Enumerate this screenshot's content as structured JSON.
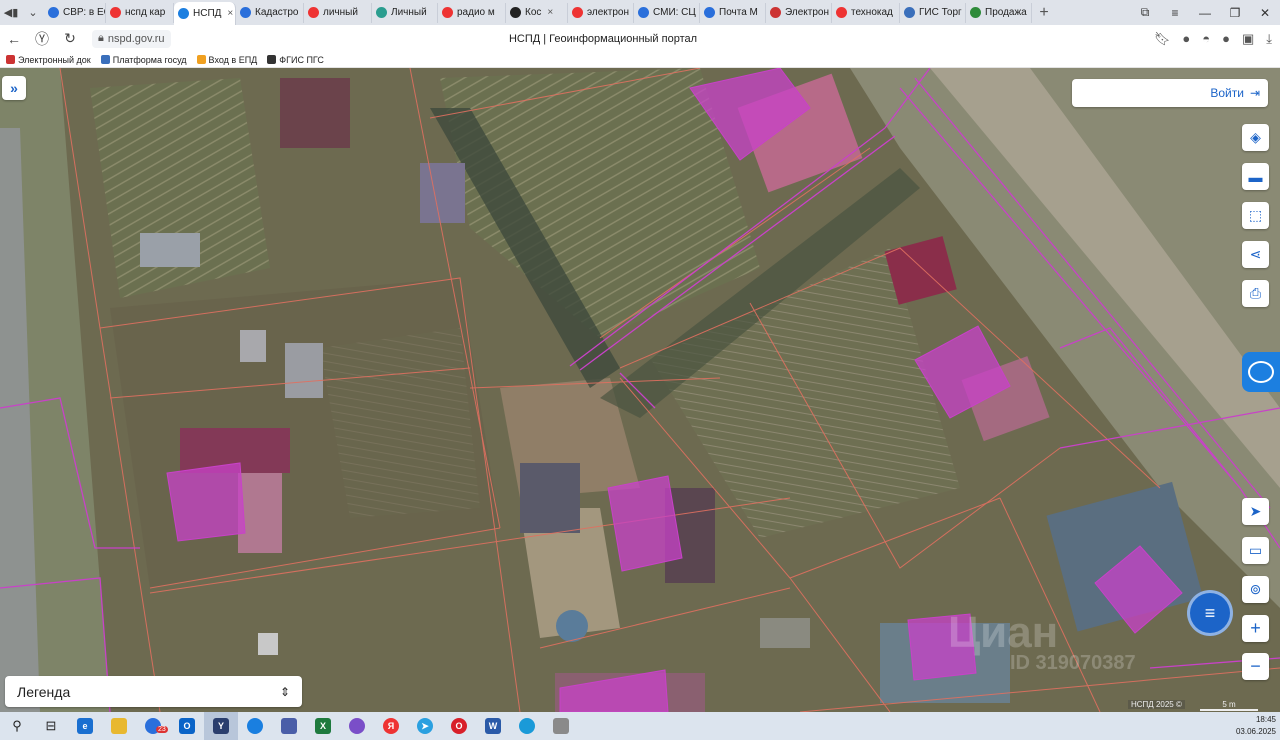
{
  "browser": {
    "tabs": [
      {
        "label": "СВР: в ЕС",
        "color": "#2a6fdb",
        "active": false
      },
      {
        "label": "нспд кар",
        "color": "#e33",
        "active": false
      },
      {
        "label": "НСПД",
        "color": "#1c7fe0",
        "active": true
      },
      {
        "label": "Кадастро",
        "color": "#2a6fdb",
        "active": false
      },
      {
        "label": "личный",
        "color": "#e33",
        "active": false
      },
      {
        "label": "Личный",
        "color": "#2a9d8f",
        "active": false
      },
      {
        "label": "радио м",
        "color": "#e33",
        "active": false
      },
      {
        "label": "Кос",
        "color": "#222",
        "active": false
      },
      {
        "label": "электрон",
        "color": "#e33",
        "active": false
      },
      {
        "label": "СМИ: СЦ",
        "color": "#2a6fdb",
        "active": false
      },
      {
        "label": "Почта М",
        "color": "#2a6fdb",
        "active": false
      },
      {
        "label": "Электрон",
        "color": "#c33",
        "active": false
      },
      {
        "label": "технокад",
        "color": "#e33",
        "active": false
      },
      {
        "label": "ГИС Торг",
        "color": "#3a6fbb",
        "active": false
      },
      {
        "label": "Продажа",
        "color": "#2e8b3a",
        "active": false
      }
    ],
    "close_glyph": "×",
    "new_tab": "+",
    "url": "nspd.gov.ru",
    "page_title": "НСПД | Геоинформационный портал",
    "bookmarks": [
      {
        "label": "Электронный док",
        "color": "#c33"
      },
      {
        "label": "Платформа госуд",
        "color": "#3a6fbb"
      },
      {
        "label": "Вход в ЕПД",
        "color": "#f0a020"
      },
      {
        "label": "ФГИС ПГС",
        "color": "#333"
      }
    ]
  },
  "map": {
    "toggle_glyph": "»",
    "login_label": "Войти",
    "tools": [
      "layers-icon",
      "ruler-icon",
      "select-area-icon",
      "share-icon",
      "print-icon"
    ],
    "nav_tools": [
      "locate-icon",
      "basemap-icon",
      "geo-search-icon",
      "zoom-in-icon",
      "zoom-out-icon"
    ],
    "zoom_in": "+",
    "zoom_out": "−",
    "watermark_brand": "Циан",
    "watermark_id": "ID 319070387",
    "legend_label": "Легенда",
    "copyright": "НСПД 2025 ©",
    "scale_label": "5 m",
    "parcel_color": "#c842c8",
    "boundary_color": "#e07060"
  },
  "taskbar": {
    "time": "18:45",
    "date": "03.06.2025",
    "mail_badge": "23"
  }
}
